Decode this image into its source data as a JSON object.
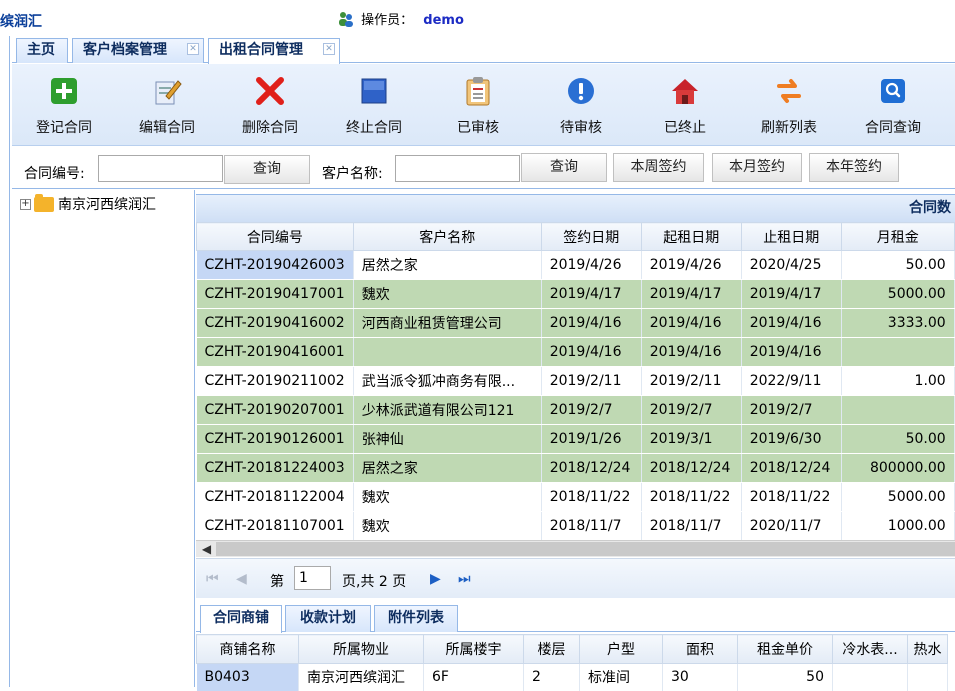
{
  "header": {
    "brand": "缤润汇",
    "operator_label": "操作员：",
    "operator_name": "demo"
  },
  "tabs": [
    {
      "label": "主页"
    },
    {
      "label": "客户档案管理"
    },
    {
      "label": "出租合同管理"
    }
  ],
  "toolbar": {
    "items": [
      {
        "label": "登记合同",
        "icon": "add-icon"
      },
      {
        "label": "编辑合同",
        "icon": "edit-icon"
      },
      {
        "label": "删除合同",
        "icon": "delete-icon"
      },
      {
        "label": "终止合同",
        "icon": "stop-icon"
      },
      {
        "label": "已审核",
        "icon": "clipboard-icon"
      },
      {
        "label": "待审核",
        "icon": "pending-icon"
      },
      {
        "label": "已终止",
        "icon": "home-icon"
      },
      {
        "label": "刷新列表",
        "icon": "refresh-icon"
      },
      {
        "label": "合同查询",
        "icon": "query-icon"
      }
    ]
  },
  "search": {
    "contract_no_label": "合同编号:",
    "customer_name_label": "客户名称:",
    "query1": "查询",
    "query2": "查询",
    "week": "本周签约",
    "month": "本月签约",
    "year": "本年签约"
  },
  "tree": {
    "root": "南京河西缤润汇"
  },
  "grid": {
    "title": "合同数",
    "columns": [
      "合同编号",
      "客户名称",
      "签约日期",
      "起租日期",
      "止租日期",
      "月租金"
    ],
    "rows": [
      [
        "CZHT-20190426003",
        "居然之家",
        "2019/4/26",
        "2019/4/26",
        "2020/4/25",
        "50.00"
      ],
      [
        "CZHT-20190417001",
        "魏欢",
        "2019/4/17",
        "2019/4/17",
        "2019/4/17",
        "5000.00"
      ],
      [
        "CZHT-20190416002",
        "河西商业租赁管理公司",
        "2019/4/16",
        "2019/4/16",
        "2019/4/16",
        "3333.00"
      ],
      [
        "CZHT-20190416001",
        "",
        "2019/4/16",
        "2019/4/16",
        "2019/4/16",
        ""
      ],
      [
        "CZHT-20190211002",
        "武当派令狐冲商务有限...",
        "2019/2/11",
        "2019/2/11",
        "2022/9/11",
        "1.00"
      ],
      [
        "CZHT-20190207001",
        "少林派武道有限公司121",
        "2019/2/7",
        "2019/2/7",
        "2019/2/7",
        ""
      ],
      [
        "CZHT-20190126001",
        "张神仙",
        "2019/1/26",
        "2019/3/1",
        "2019/6/30",
        "50.00"
      ],
      [
        "CZHT-20181224003",
        "居然之家",
        "2018/12/24",
        "2018/12/24",
        "2018/12/24",
        "800000.00"
      ],
      [
        "CZHT-20181122004",
        "魏欢",
        "2018/11/22",
        "2018/11/22",
        "2018/11/22",
        "5000.00"
      ],
      [
        "CZHT-20181107001",
        "魏欢",
        "2018/11/7",
        "2018/11/7",
        "2020/11/7",
        "1000.00"
      ]
    ]
  },
  "pager": {
    "page_prefix": "第",
    "page_value": "1",
    "page_suffix": "页,共 2 页"
  },
  "bottom_tabs": [
    {
      "label": "合同商铺"
    },
    {
      "label": "收款计划"
    },
    {
      "label": "附件列表"
    }
  ],
  "sub_grid": {
    "columns": [
      "商铺名称",
      "所属物业",
      "所属楼宇",
      "楼层",
      "户型",
      "面积",
      "租金单价",
      "冷水表...",
      "热水"
    ],
    "rows": [
      [
        "B0403",
        "南京河西缤润汇",
        "6F",
        "2",
        "标准间",
        "30",
        "50",
        "",
        ""
      ]
    ]
  },
  "colors": {
    "accent": "#95b8e7",
    "green_row": "#bfd9b3",
    "selected": "#c5d7f5"
  }
}
